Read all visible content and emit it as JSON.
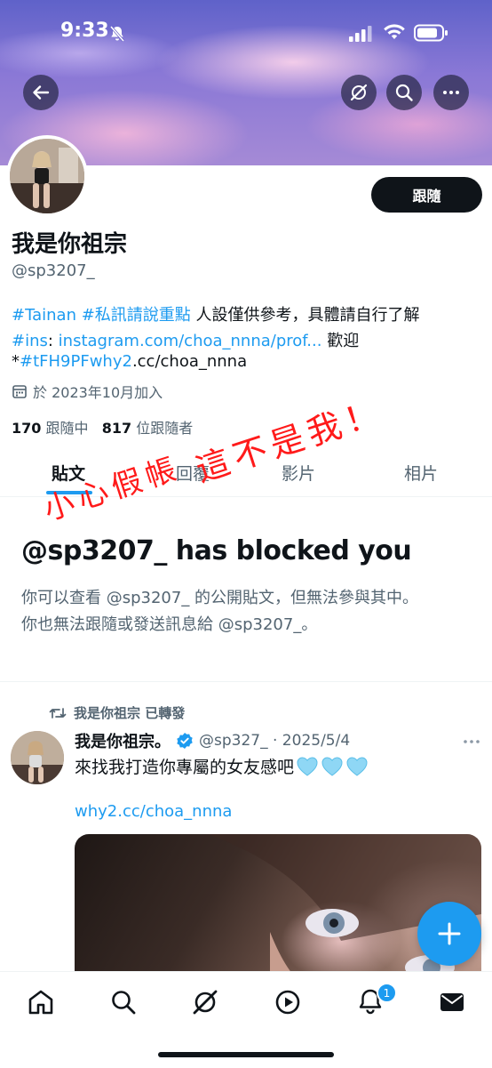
{
  "status_bar": {
    "time": "9:33"
  },
  "header": {
    "back_icon": "arrow-left-icon",
    "grok_icon": "grok-icon",
    "search_icon": "search-icon",
    "more_icon": "more-icon"
  },
  "profile": {
    "follow_label": "跟隨",
    "display_name": "我是你祖宗",
    "handle": "@sp3207_",
    "bio": {
      "line1": {
        "tag1": "#Tainan",
        "tag2": "#私訊請說重點",
        "text": " 人設僅供參考，具體請自行了解"
      },
      "line2": {
        "tag": "#ins",
        "colon": ": ",
        "link": "instagram.com/choa_nnna/prof...",
        "text": " 歡迎"
      },
      "line3": {
        "prefix": "*",
        "tag": "#tFH9PFwhy2",
        "text": ".cc/choa_nnna"
      }
    },
    "joined": "於 2023年10月加入",
    "following_count": "170",
    "following_label": "跟隨中",
    "followers_count": "817",
    "followers_label": "位跟隨者"
  },
  "tabs": [
    "貼文",
    "回覆",
    "影片",
    "相片"
  ],
  "annotation": {
    "text1": "小心假帳",
    "text2": "這不是我！",
    "color": "#ff1a1a"
  },
  "blocked": {
    "title": "@sp3207_ has blocked you",
    "line1": "你可以查看 @sp3207_ 的公開貼文，但無法參與其中。",
    "line2": "你也無法跟隨或發送訊息給 @sp3207_。"
  },
  "post": {
    "retweet_label": "我是你祖宗 已轉發",
    "author_name": "我是你祖宗。",
    "meta": "@sp327_ · 2025/5/4",
    "text": "來找我打造你專屬的女友感吧",
    "emoji": [
      "light-blue-heart-icon",
      "light-blue-heart-icon",
      "light-blue-heart-icon"
    ],
    "link": "why2.cc/choa_nnna"
  },
  "nav": {
    "items": [
      "home-icon",
      "search-icon",
      "grok-icon",
      "video-icon",
      "notifications-icon",
      "messages-icon"
    ],
    "notification_badge": "1"
  },
  "colors": {
    "accent": "#1d9bf0",
    "text": "#0f1419",
    "secondary": "#536471"
  }
}
